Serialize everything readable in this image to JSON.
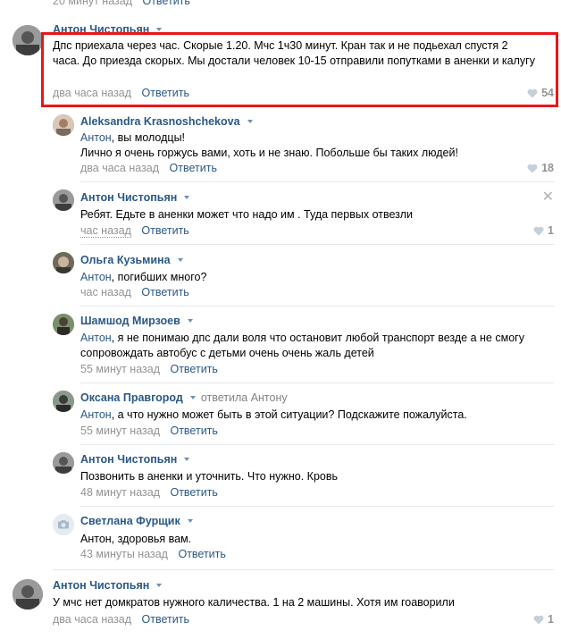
{
  "top_stub": {
    "time": "20 минут назад",
    "reply": "Ответить"
  },
  "comments": [
    {
      "author": "Антон Чистопьян",
      "text": "Дпс приехала через час. Скорые 1.20. Мчс 1ч30 минут. Кран так и не подьехал спустя 2 часа. До приезда скорых. Мы достали человек 10-15 отправили попутками в аненки и калугу",
      "time": "два часа назад",
      "reply": "Ответить",
      "likes": "54"
    },
    {
      "author": "Aleksandra Krasnoshchekova",
      "addressee": "Антон",
      "text": ", вы молодцы!\nЛично я очень горжусь вами, хоть и не знаю. Побольше бы таких людей!",
      "time": "два часа назад",
      "reply": "Ответить",
      "likes": "18"
    },
    {
      "author": "Антон Чистопьян",
      "text": "Ребят. Едьте в аненки может что надо им . Туда первых отвезли",
      "time": "час назад",
      "reply": "Ответить",
      "likes": "1"
    },
    {
      "author": "Ольга Кузьмина",
      "addressee": "Антон",
      "text": ", погибших много?",
      "time": "час назад",
      "reply": "Ответить"
    },
    {
      "author": "Шамшод Мирзоев",
      "addressee": "Антон",
      "text": ", я не понимаю дпс дали воля что остановит любой транспорт везде а не смогу сопровождать автобус с детьми очень очень жаль детей",
      "time": "55 минут назад",
      "reply": "Ответить"
    },
    {
      "author": "Оксана Правгород",
      "replied_to": "ответила Антону",
      "addressee": "Антон",
      "text": ", а что нужно может быть в этой ситуации? Подскажите пожалуйста.",
      "time": "55 минут назад",
      "reply": "Ответить"
    },
    {
      "author": "Антон Чистопьян",
      "text": "Позвонить в аненки и уточнить. Что нужно. Кровь",
      "time": "48 минут назад",
      "reply": "Ответить"
    },
    {
      "author": "Светлана Фурщик",
      "text": "Антон, здоровья вам.",
      "time": "43 минуты назад",
      "reply": "Ответить"
    },
    {
      "author": "Антон Чистопьян",
      "text": "У мчс нет домкратов нужного каличества. 1 на 2 машины. Хотя им гоаворили",
      "time": "два часа назад",
      "reply": "Ответить",
      "likes": "1"
    }
  ],
  "colors": {
    "link": "#2a5885",
    "meta": "#939393",
    "highlight": "#e8161a",
    "separator": "#e7e8ec"
  },
  "icons": [
    "heart-icon",
    "close-icon",
    "camera-icon",
    "chevron-down-icon"
  ]
}
